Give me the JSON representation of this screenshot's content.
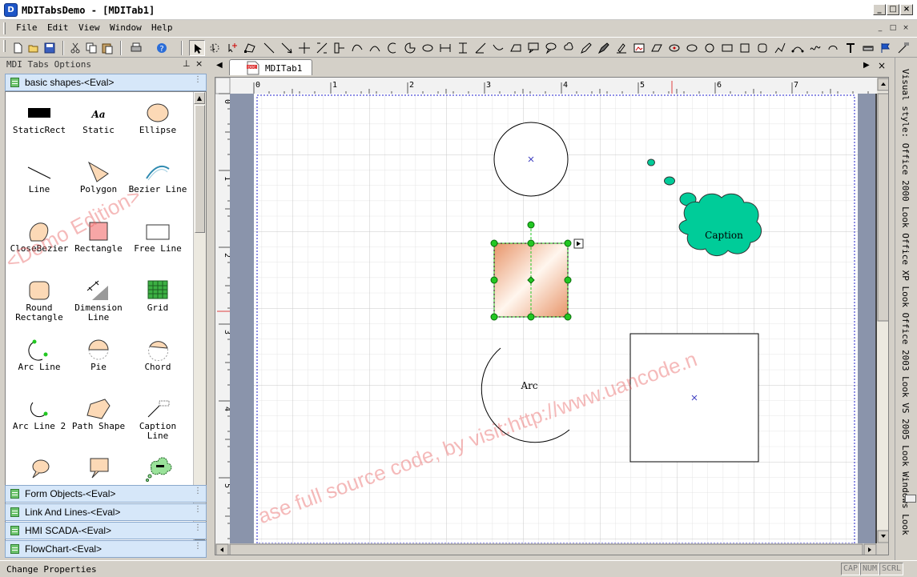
{
  "window": {
    "app_icon": "D",
    "title": "MDITabsDemo - [MDITab1]",
    "minimize_glyph": "_",
    "maximize_glyph": "□",
    "close_glyph": "×"
  },
  "menu": {
    "items": [
      "File",
      "Edit",
      "View",
      "Window",
      "Help"
    ],
    "mdi_controls": [
      "_",
      "□",
      "×"
    ]
  },
  "toolbar": {
    "buttons": [
      "new-icon",
      "open-icon",
      "save-icon",
      "cut-icon",
      "copy-icon",
      "paste-icon",
      "print-icon",
      "help-icon",
      "pointer-icon",
      "rotate-icon",
      "add-point-icon",
      "edit-polygon-icon",
      "line-icon",
      "arrow-line-icon",
      "cross-icon",
      "connector-icon",
      "link-icon",
      "bezier-icon",
      "arc-icon",
      "pie-icon",
      "chord-icon",
      "dimension-icon",
      "vertical-dimension-icon",
      "curve-icon",
      "arrow-tool-icon",
      "rectangle-tool-icon",
      "caption-icon",
      "callout-icon",
      "callout-round-icon",
      "caption-line-icon"
    ]
  },
  "left_panel": {
    "title": "MDI Tabs Options",
    "pin_glyph": "⊥",
    "close_glyph": "×",
    "active_group": "basic shapes-<Eval>",
    "shapes": [
      {
        "label": "StaticRect",
        "icon": "static-rect-icon"
      },
      {
        "label": "Static",
        "icon": "static-text-icon",
        "glyph": "Aa"
      },
      {
        "label": "Ellipse",
        "icon": "ellipse-icon"
      },
      {
        "label": "Line",
        "icon": "line-icon"
      },
      {
        "label": "Polygon",
        "icon": "polygon-icon"
      },
      {
        "label": "Bezier Line",
        "icon": "bezier-line-icon"
      },
      {
        "label": "CloseBezier",
        "icon": "close-bezier-icon"
      },
      {
        "label": "Rectangle",
        "icon": "rectangle-icon"
      },
      {
        "label": "Free Line",
        "icon": "free-line-icon"
      },
      {
        "label": "Round Rectangle",
        "icon": "round-rectangle-icon"
      },
      {
        "label": "Dimension Line",
        "icon": "dimension-line-icon"
      },
      {
        "label": "Grid",
        "icon": "grid-icon"
      },
      {
        "label": "Arc Line",
        "icon": "arc-line-icon"
      },
      {
        "label": "Pie",
        "icon": "pie-icon"
      },
      {
        "label": "Chord",
        "icon": "chord-icon"
      },
      {
        "label": "Arc Line 2",
        "icon": "arc-line-2-icon"
      },
      {
        "label": "Path Shape",
        "icon": "path-shape-icon"
      },
      {
        "label": "Caption Line",
        "icon": "caption-line-icon"
      }
    ],
    "groups": [
      "Form Objects-<Eval>",
      "Link And Lines-<Eval>",
      "HMI SCADA-<Eval>",
      "FlowChart-<Eval>"
    ]
  },
  "document": {
    "tab_label": "MDITab1",
    "tab_icon_text": "DOC",
    "nav_prev": "◀",
    "nav_next": "▶",
    "close_glyph": "×",
    "ruler_top_labels": [
      "0",
      "1",
      "2",
      "3",
      "4",
      "5",
      "6",
      "7"
    ],
    "ruler_left_labels": [
      "0",
      "1",
      "2",
      "3",
      "4",
      "5"
    ],
    "shapes": {
      "caption_text": "Caption",
      "arc_text": "Arc"
    }
  },
  "right_bar": {
    "text": "Visual style:  Office 2000 Look  Office XP Look  Office 2003 Look  VS 2005 Look  Windows Look"
  },
  "status": {
    "text": "Change Properties",
    "indicators": [
      "CAP",
      "NUM",
      "SCRL"
    ]
  },
  "watermarks": {
    "demo": "<Demo Edition>",
    "purchase": "ase full source code, by visit:http://www.uancode.n"
  },
  "colors": {
    "accent_green": "#00cc99",
    "handle_green": "#22c722",
    "gradient_peach": "#f2c4a8",
    "watermark_red": "#e85a5a",
    "group_bar_blue": "#d6e7f9"
  }
}
